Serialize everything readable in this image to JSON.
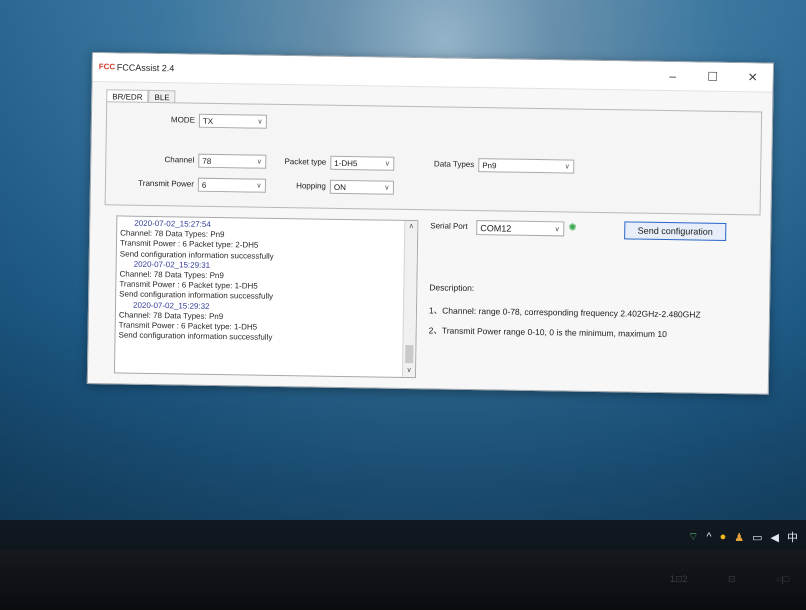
{
  "window": {
    "title": "FCCAssist 2.4",
    "app_icon": "fcc",
    "minimize": "–",
    "maximize": "☐",
    "close": "✕"
  },
  "tabs": [
    {
      "label": "BR/EDR",
      "active": true
    },
    {
      "label": "BLE",
      "active": false
    }
  ],
  "config": {
    "mode": {
      "label": "MODE",
      "value": "TX"
    },
    "channel": {
      "label": "Channel",
      "value": "78"
    },
    "packet_type": {
      "label": "Packet type",
      "value": "1-DH5"
    },
    "data_types": {
      "label": "Data Types",
      "value": "Pn9"
    },
    "transmit_power": {
      "label": "Transmit Power",
      "value": "6"
    },
    "hopping": {
      "label": "Hopping",
      "value": "ON"
    }
  },
  "log": [
    {
      "type": "ts",
      "text": "2020-07-02_15:27:54"
    },
    {
      "type": "line",
      "text": "Channel: 78           Data Types: Pn9"
    },
    {
      "type": "line",
      "text": "Transmit Power : 6     Packet type: 2-DH5"
    },
    {
      "type": "line",
      "text": "Send configuration information successfully"
    },
    {
      "type": "ts",
      "text": "2020-07-02_15:29:31"
    },
    {
      "type": "line",
      "text": "Channel: 78           Data Types: Pn9"
    },
    {
      "type": "line",
      "text": "Transmit Power : 6     Packet type: 1-DH5"
    },
    {
      "type": "line",
      "text": "Send configuration information successfully"
    },
    {
      "type": "ts",
      "text": "2020-07-02_15:29:32"
    },
    {
      "type": "line",
      "text": "Channel: 78           Data Types: Pn9"
    },
    {
      "type": "line",
      "text": "Transmit Power : 6     Packet type: 1-DH5"
    },
    {
      "type": "line",
      "text": "Send configuration information successfully"
    }
  ],
  "serial": {
    "label": "Serial Port",
    "value": "COM12",
    "status_icon": "wifi-connected"
  },
  "send_button": "Send configuration",
  "description": {
    "heading": "Description:",
    "items": [
      "1、Channel: range 0-78, corresponding frequency 2.402GHz-2.480GHZ",
      "2、Transmit Power  range 0-10, 0 is the minimum, maximum 10"
    ]
  },
  "tray": {
    "icons": [
      "wifi",
      "chevron-up",
      "notification",
      "person",
      "display",
      "volume",
      "ime"
    ],
    "ime": "中"
  },
  "bezel": {
    "labels": [
      "1⊡2",
      "⊡",
      "○|□"
    ]
  }
}
